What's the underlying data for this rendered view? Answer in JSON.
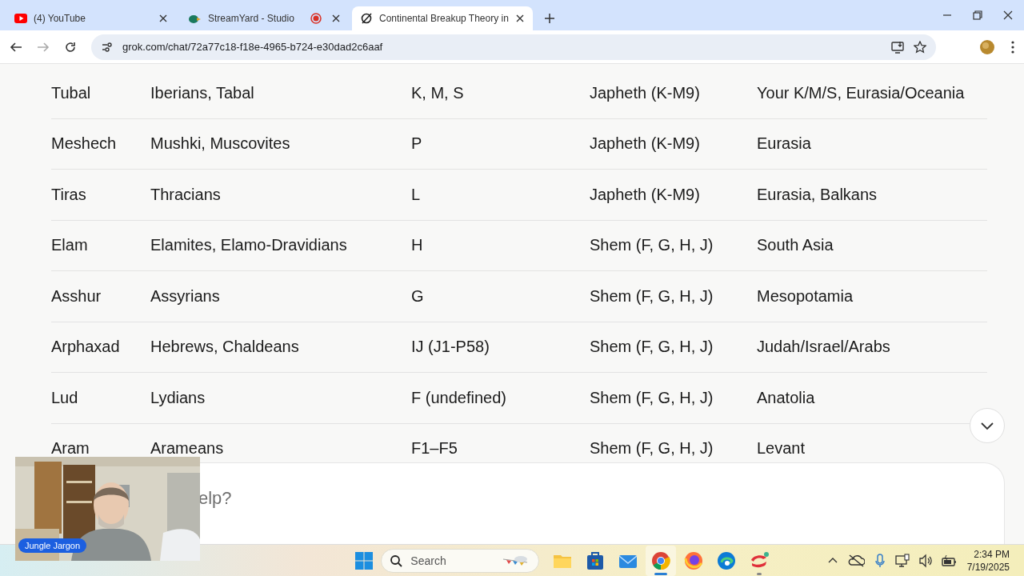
{
  "browser": {
    "tabs": [
      {
        "title": "(4) YouTube",
        "selected": false,
        "recording": false
      },
      {
        "title": "StreamYard - Studio",
        "selected": false,
        "recording": true
      },
      {
        "title": "Continental Breakup Theory in",
        "selected": true,
        "recording": false
      }
    ],
    "url": "grok.com/chat/72a77c18-f18e-4965-b724-e30dad2c6aaf"
  },
  "table": {
    "rows": [
      [
        "Tubal",
        "Iberians, Tabal",
        "K, M, S",
        "Japheth (K-M9)",
        "Your K/M/S, Eurasia/Oceania"
      ],
      [
        "Meshech",
        "Mushki, Muscovites",
        "P",
        "Japheth (K-M9)",
        "Eurasia"
      ],
      [
        "Tiras",
        "Thracians",
        "L",
        "Japheth (K-M9)",
        "Eurasia, Balkans"
      ],
      [
        "Elam",
        "Elamites, Elamo-Dravidians",
        "H",
        "Shem (F, G, H, J)",
        "South Asia"
      ],
      [
        "Asshur",
        "Assyrians",
        "G",
        "Shem (F, G, H, J)",
        "Mesopotamia"
      ],
      [
        "Arphaxad",
        "Hebrews, Chaldeans",
        "IJ (J1-P58)",
        "Shem (F, G, H, J)",
        "Judah/Israel/Arabs"
      ],
      [
        "Lud",
        "Lydians",
        "F (undefined)",
        "Shem (F, G, H, J)",
        "Anatolia"
      ],
      [
        "Aram",
        "Arameans",
        "F1–F5",
        "Shem (F, G, H, J)",
        "Levant"
      ]
    ]
  },
  "composer": {
    "placeholder": "elp?"
  },
  "webcam": {
    "kind": "picture",
    "name": "Jungle Jargon"
  },
  "taskbar": {
    "search_placeholder": "Search",
    "apps": [
      {
        "kind": "folder",
        "running": false,
        "active": false
      },
      {
        "kind": "store",
        "running": false,
        "active": false
      },
      {
        "kind": "mail",
        "running": false,
        "active": false
      },
      {
        "kind": "chrome",
        "running": true,
        "active": true
      },
      {
        "kind": "firefox",
        "running": false,
        "active": false
      },
      {
        "kind": "edge",
        "running": false,
        "active": false
      },
      {
        "kind": "red-app",
        "running": true,
        "active": false
      }
    ],
    "time": "2:34 PM",
    "date": "7/19/2025"
  }
}
